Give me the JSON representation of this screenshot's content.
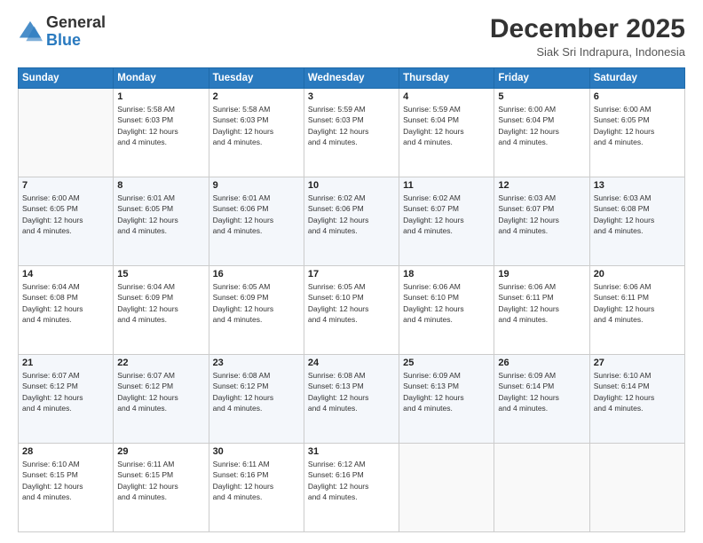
{
  "header": {
    "logo_general": "General",
    "logo_blue": "Blue",
    "month": "December 2025",
    "location": "Siak Sri Indrapura, Indonesia"
  },
  "days_of_week": [
    "Sunday",
    "Monday",
    "Tuesday",
    "Wednesday",
    "Thursday",
    "Friday",
    "Saturday"
  ],
  "weeks": [
    [
      {
        "day": "",
        "empty": true
      },
      {
        "day": "1",
        "sunrise": "Sunrise: 5:58 AM",
        "sunset": "Sunset: 6:03 PM",
        "daylight": "Daylight: 12 hours and 4 minutes."
      },
      {
        "day": "2",
        "sunrise": "Sunrise: 5:58 AM",
        "sunset": "Sunset: 6:03 PM",
        "daylight": "Daylight: 12 hours and 4 minutes."
      },
      {
        "day": "3",
        "sunrise": "Sunrise: 5:59 AM",
        "sunset": "Sunset: 6:03 PM",
        "daylight": "Daylight: 12 hours and 4 minutes."
      },
      {
        "day": "4",
        "sunrise": "Sunrise: 5:59 AM",
        "sunset": "Sunset: 6:04 PM",
        "daylight": "Daylight: 12 hours and 4 minutes."
      },
      {
        "day": "5",
        "sunrise": "Sunrise: 6:00 AM",
        "sunset": "Sunset: 6:04 PM",
        "daylight": "Daylight: 12 hours and 4 minutes."
      },
      {
        "day": "6",
        "sunrise": "Sunrise: 6:00 AM",
        "sunset": "Sunset: 6:05 PM",
        "daylight": "Daylight: 12 hours and 4 minutes."
      }
    ],
    [
      {
        "day": "7",
        "sunrise": "Sunrise: 6:00 AM",
        "sunset": "Sunset: 6:05 PM",
        "daylight": "Daylight: 12 hours and 4 minutes."
      },
      {
        "day": "8",
        "sunrise": "Sunrise: 6:01 AM",
        "sunset": "Sunset: 6:05 PM",
        "daylight": "Daylight: 12 hours and 4 minutes."
      },
      {
        "day": "9",
        "sunrise": "Sunrise: 6:01 AM",
        "sunset": "Sunset: 6:06 PM",
        "daylight": "Daylight: 12 hours and 4 minutes."
      },
      {
        "day": "10",
        "sunrise": "Sunrise: 6:02 AM",
        "sunset": "Sunset: 6:06 PM",
        "daylight": "Daylight: 12 hours and 4 minutes."
      },
      {
        "day": "11",
        "sunrise": "Sunrise: 6:02 AM",
        "sunset": "Sunset: 6:07 PM",
        "daylight": "Daylight: 12 hours and 4 minutes."
      },
      {
        "day": "12",
        "sunrise": "Sunrise: 6:03 AM",
        "sunset": "Sunset: 6:07 PM",
        "daylight": "Daylight: 12 hours and 4 minutes."
      },
      {
        "day": "13",
        "sunrise": "Sunrise: 6:03 AM",
        "sunset": "Sunset: 6:08 PM",
        "daylight": "Daylight: 12 hours and 4 minutes."
      }
    ],
    [
      {
        "day": "14",
        "sunrise": "Sunrise: 6:04 AM",
        "sunset": "Sunset: 6:08 PM",
        "daylight": "Daylight: 12 hours and 4 minutes."
      },
      {
        "day": "15",
        "sunrise": "Sunrise: 6:04 AM",
        "sunset": "Sunset: 6:09 PM",
        "daylight": "Daylight: 12 hours and 4 minutes."
      },
      {
        "day": "16",
        "sunrise": "Sunrise: 6:05 AM",
        "sunset": "Sunset: 6:09 PM",
        "daylight": "Daylight: 12 hours and 4 minutes."
      },
      {
        "day": "17",
        "sunrise": "Sunrise: 6:05 AM",
        "sunset": "Sunset: 6:10 PM",
        "daylight": "Daylight: 12 hours and 4 minutes."
      },
      {
        "day": "18",
        "sunrise": "Sunrise: 6:06 AM",
        "sunset": "Sunset: 6:10 PM",
        "daylight": "Daylight: 12 hours and 4 minutes."
      },
      {
        "day": "19",
        "sunrise": "Sunrise: 6:06 AM",
        "sunset": "Sunset: 6:11 PM",
        "daylight": "Daylight: 12 hours and 4 minutes."
      },
      {
        "day": "20",
        "sunrise": "Sunrise: 6:06 AM",
        "sunset": "Sunset: 6:11 PM",
        "daylight": "Daylight: 12 hours and 4 minutes."
      }
    ],
    [
      {
        "day": "21",
        "sunrise": "Sunrise: 6:07 AM",
        "sunset": "Sunset: 6:12 PM",
        "daylight": "Daylight: 12 hours and 4 minutes."
      },
      {
        "day": "22",
        "sunrise": "Sunrise: 6:07 AM",
        "sunset": "Sunset: 6:12 PM",
        "daylight": "Daylight: 12 hours and 4 minutes."
      },
      {
        "day": "23",
        "sunrise": "Sunrise: 6:08 AM",
        "sunset": "Sunset: 6:12 PM",
        "daylight": "Daylight: 12 hours and 4 minutes."
      },
      {
        "day": "24",
        "sunrise": "Sunrise: 6:08 AM",
        "sunset": "Sunset: 6:13 PM",
        "daylight": "Daylight: 12 hours and 4 minutes."
      },
      {
        "day": "25",
        "sunrise": "Sunrise: 6:09 AM",
        "sunset": "Sunset: 6:13 PM",
        "daylight": "Daylight: 12 hours and 4 minutes."
      },
      {
        "day": "26",
        "sunrise": "Sunrise: 6:09 AM",
        "sunset": "Sunset: 6:14 PM",
        "daylight": "Daylight: 12 hours and 4 minutes."
      },
      {
        "day": "27",
        "sunrise": "Sunrise: 6:10 AM",
        "sunset": "Sunset: 6:14 PM",
        "daylight": "Daylight: 12 hours and 4 minutes."
      }
    ],
    [
      {
        "day": "28",
        "sunrise": "Sunrise: 6:10 AM",
        "sunset": "Sunset: 6:15 PM",
        "daylight": "Daylight: 12 hours and 4 minutes."
      },
      {
        "day": "29",
        "sunrise": "Sunrise: 6:11 AM",
        "sunset": "Sunset: 6:15 PM",
        "daylight": "Daylight: 12 hours and 4 minutes."
      },
      {
        "day": "30",
        "sunrise": "Sunrise: 6:11 AM",
        "sunset": "Sunset: 6:16 PM",
        "daylight": "Daylight: 12 hours and 4 minutes."
      },
      {
        "day": "31",
        "sunrise": "Sunrise: 6:12 AM",
        "sunset": "Sunset: 6:16 PM",
        "daylight": "Daylight: 12 hours and 4 minutes."
      },
      {
        "day": "",
        "empty": true
      },
      {
        "day": "",
        "empty": true
      },
      {
        "day": "",
        "empty": true
      }
    ]
  ]
}
